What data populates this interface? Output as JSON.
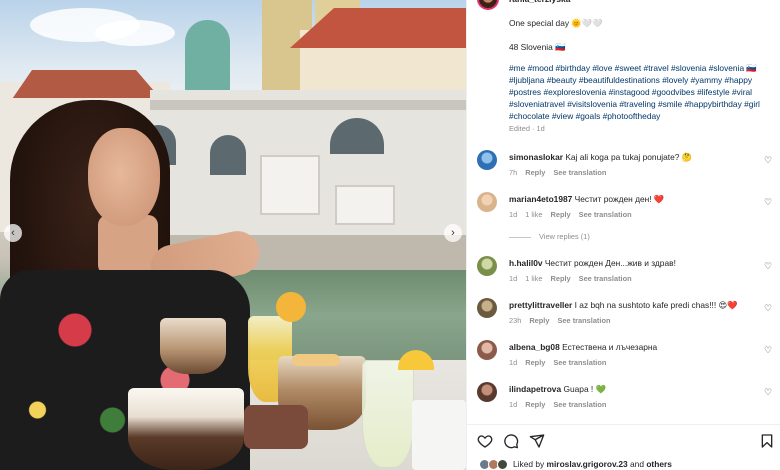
{
  "post": {
    "username": "rania_terziyska",
    "caption_line1": "One special day 🌞🤍🤍",
    "caption_line2": "48 Slovenia 🇸🇮",
    "hashtags": "#me #mood #birthday #love #sweet #travel #slovenia #slovenia 🇸🇮 #ljubljana #beauty #beautifuldestinations #lovely #yammy #happy #postres #exploreslovenia #instagood #goodvibes #lifestyle #viral #sloveniatravel #visitslovenia #traveling #smile #happybirthday #girl #chocolate #view #goals #photooftheday",
    "edited": "Edited · 1d"
  },
  "comments": [
    {
      "user": "simonaslokar",
      "text": "Kaj ali koga pa tukaj ponujate? 🤔",
      "time": "7h",
      "likes": "",
      "reply": "Reply",
      "translate": "See translation",
      "avatar_color": "#2f6fb3"
    },
    {
      "user": "marian4eto1987",
      "text": "Честит рожден ден! ❤️",
      "time": "1d",
      "likes": "1 like",
      "reply": "Reply",
      "translate": "See translation",
      "avatar_color": "#d9b38c"
    },
    {
      "user": "h.halil0v",
      "text": "Честит рожден Ден...жив и здрав!",
      "time": "1d",
      "likes": "1 like",
      "reply": "Reply",
      "translate": "See translation",
      "avatar_color": "#7a8f4a"
    },
    {
      "user": "prettylittraveller",
      "text": "I az bqh na sushtoto kafe predi chas!!! 😍❤️",
      "time": "23h",
      "likes": "",
      "reply": "Reply",
      "translate": "See translation",
      "avatar_color": "#6b5a3e"
    },
    {
      "user": "albena_bg08",
      "text": "Естествена и лъчезарна",
      "time": "1d",
      "likes": "",
      "reply": "Reply",
      "translate": "See translation",
      "avatar_color": "#8c5a4a"
    },
    {
      "user": "ilindapetrova",
      "text": "Guapa ! 💚",
      "time": "1d",
      "likes": "",
      "reply": "Reply",
      "translate": "See translation",
      "avatar_color": "#5a3a2e"
    }
  ],
  "view_replies": "View replies (1)",
  "likes": {
    "prefix": "Liked by ",
    "user": "miroslav.grigorov.23",
    "middle": " and ",
    "others": "others"
  },
  "icons": [
    "heart-icon",
    "comment-icon",
    "share-icon",
    "save-icon",
    "chevron-left-icon",
    "chevron-right-icon"
  ],
  "colors": {
    "link": "#00376b",
    "meta": "#8e8e8e",
    "text": "#262626",
    "story_ring": "#e1306c"
  }
}
